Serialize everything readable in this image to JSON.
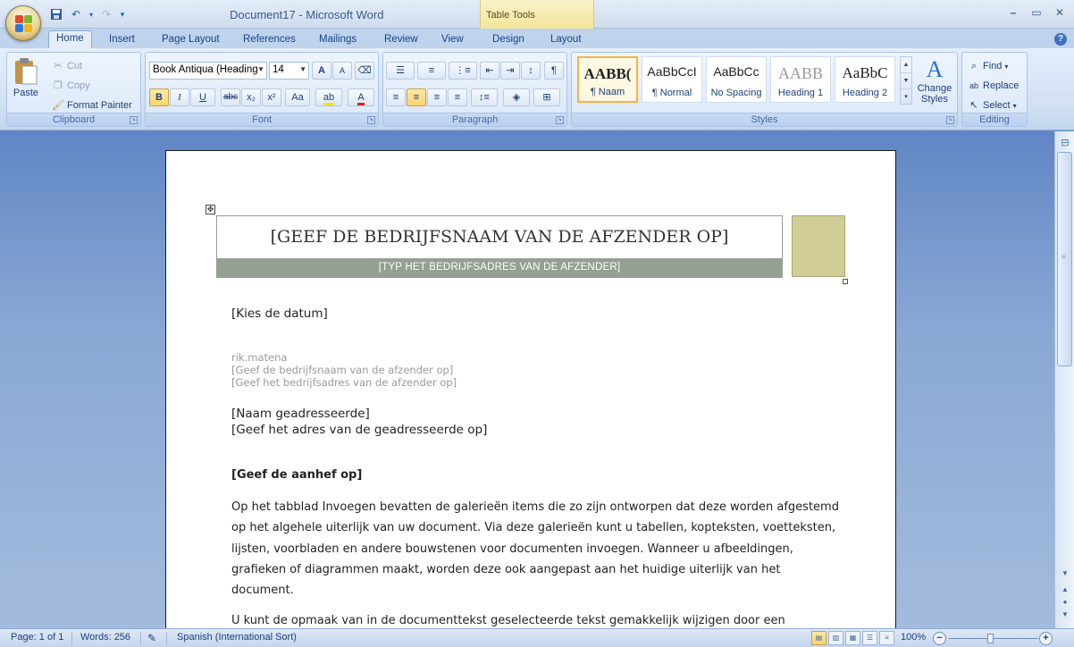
{
  "window": {
    "title": "Document17  -  Microsoft Word",
    "context_tab_group": "Table Tools",
    "controls": [
      "–",
      "▭",
      "✕"
    ]
  },
  "quick_access": {
    "save": "save-icon",
    "undo": "undo-icon",
    "redo": "redo-icon",
    "customize": "▾"
  },
  "tabs": [
    {
      "label": "Home",
      "active": true
    },
    {
      "label": "Insert"
    },
    {
      "label": "Page Layout"
    },
    {
      "label": "References"
    },
    {
      "label": "Mailings"
    },
    {
      "label": "Review"
    },
    {
      "label": "View"
    },
    {
      "label": "Design"
    },
    {
      "label": "Layout"
    }
  ],
  "ribbon": {
    "clipboard": {
      "label": "Clipboard",
      "paste": "Paste",
      "cut": "Cut",
      "copy": "Copy",
      "format_painter": "Format Painter"
    },
    "font": {
      "label": "Font",
      "font_name": "Book Antiqua (Heading",
      "font_size": "14",
      "buttons": {
        "bold": "B",
        "italic": "I",
        "underline": "U",
        "strike": "abc",
        "subscript": "x₂",
        "superscript": "x²",
        "case": "Aa",
        "grow": "A",
        "shrink": "A"
      }
    },
    "paragraph": {
      "label": "Paragraph"
    },
    "styles": {
      "label": "Styles",
      "items": [
        {
          "sample": "AABB(",
          "name": "¶ Naam",
          "selected": true
        },
        {
          "sample": "AaBbCcI",
          "name": "¶ Normal"
        },
        {
          "sample": "AaBbCc",
          "name": "No Spacing"
        },
        {
          "sample": "AABB",
          "name": "Heading 1"
        },
        {
          "sample": "AaBbC",
          "name": "Heading 2"
        }
      ],
      "change_styles": "Change Styles"
    },
    "editing": {
      "label": "Editing",
      "find": "Find",
      "replace": "Replace",
      "select": "Select"
    }
  },
  "document": {
    "company_name": "[GEEF DE BEDRIJFSNAAM VAN DE AFZENDER OP]",
    "company_address": "[TYP HET BEDRIJFSADRES VAN DE AFZENDER]",
    "date": "[Kies de datum]",
    "sender": {
      "name": "rik.matena",
      "company": "[Geef de bedrijfsnaam van de afzender op]",
      "address": "[Geef het bedrijfsadres van de afzender op]"
    },
    "recipient": {
      "name": "[Naam geadresseerde]",
      "address": "[Geef het adres van de geadresseerde op]"
    },
    "salutation": "[Geef de aanhef op]",
    "paragraph1": "Op het tabblad Invoegen bevatten de galerieën items die zo zijn ontworpen dat deze worden afgestemd op het algehele uiterlijk van uw document. Via deze galerieën kunt u tabellen, kopteksten, voetteksten, lijsten, voorbladen en andere bouwstenen voor documenten invoegen. Wanneer u afbeeldingen, grafieken of diagrammen maakt, worden deze ook aangepast aan het huidige uiterlijk van het document.",
    "paragraph2": "U kunt de opmaak van in de documenttekst geselecteerde tekst gemakkelijk wijzigen door een"
  },
  "status": {
    "page": "Page: 1 of 1",
    "words": "Words: 256",
    "language": "Spanish (International Sort)",
    "zoom": "100%"
  }
}
